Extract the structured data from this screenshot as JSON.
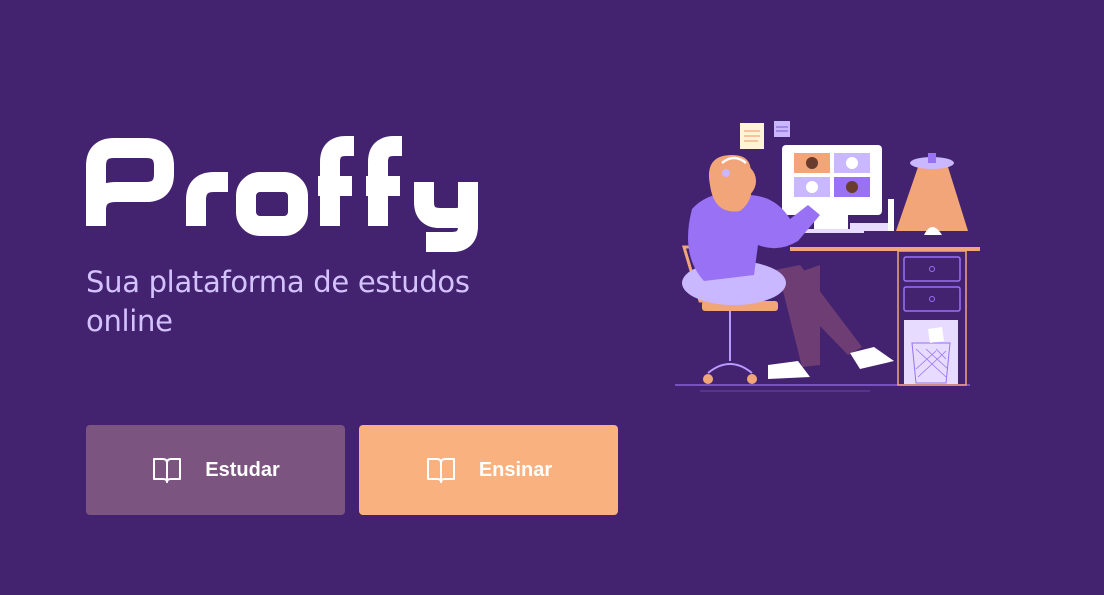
{
  "app": {
    "logo_text": "Proffy",
    "tagline": "Sua plataforma de estudos online"
  },
  "buttons": [
    {
      "label": "Estudar",
      "icon": "book-open-icon",
      "color": "#7b5580"
    },
    {
      "label": "Ensinar",
      "icon": "book-open-icon",
      "color": "#f8b17f"
    }
  ],
  "colors": {
    "background": "#432370",
    "tagline": "#d4c2ff",
    "accent_purple": "#9871f5",
    "accent_orange": "#f8b17f"
  }
}
